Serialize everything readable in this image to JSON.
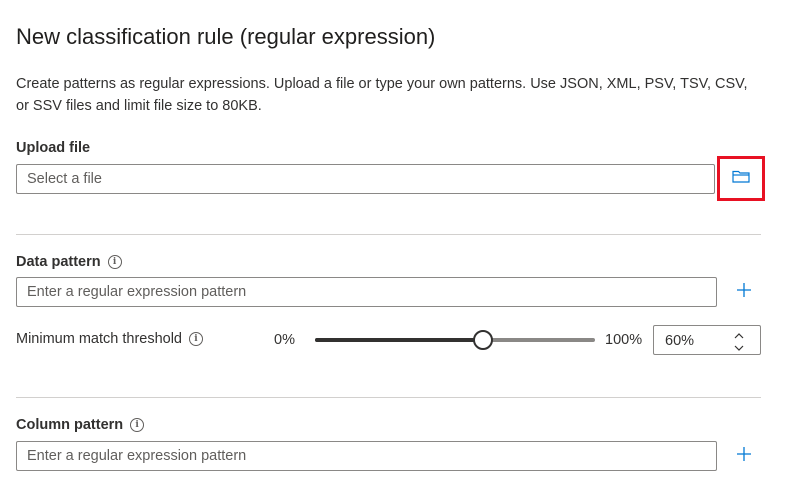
{
  "page": {
    "title": "New classification rule (regular expression)",
    "description": "Create patterns as regular expressions. Upload a file or type your own patterns. Use JSON, XML, PSV, TSV, CSV, or SSV files and limit file size to 80KB."
  },
  "upload": {
    "label": "Upload file",
    "placeholder": "Select a file",
    "browse_icon": "folder-icon",
    "highlight_color": "#e81123"
  },
  "data_pattern": {
    "label": "Data pattern",
    "placeholder": "Enter a regular expression pattern",
    "add_icon": "plus-icon"
  },
  "threshold": {
    "label": "Minimum match threshold",
    "min_label": "0%",
    "max_label": "100%",
    "value": "60%",
    "fraction": 0.6
  },
  "column_pattern": {
    "label": "Column pattern",
    "placeholder": "Enter a regular expression pattern",
    "add_icon": "plus-icon"
  },
  "colors": {
    "accent": "#0078d4",
    "text": "#323130",
    "border": "#8a8886"
  }
}
